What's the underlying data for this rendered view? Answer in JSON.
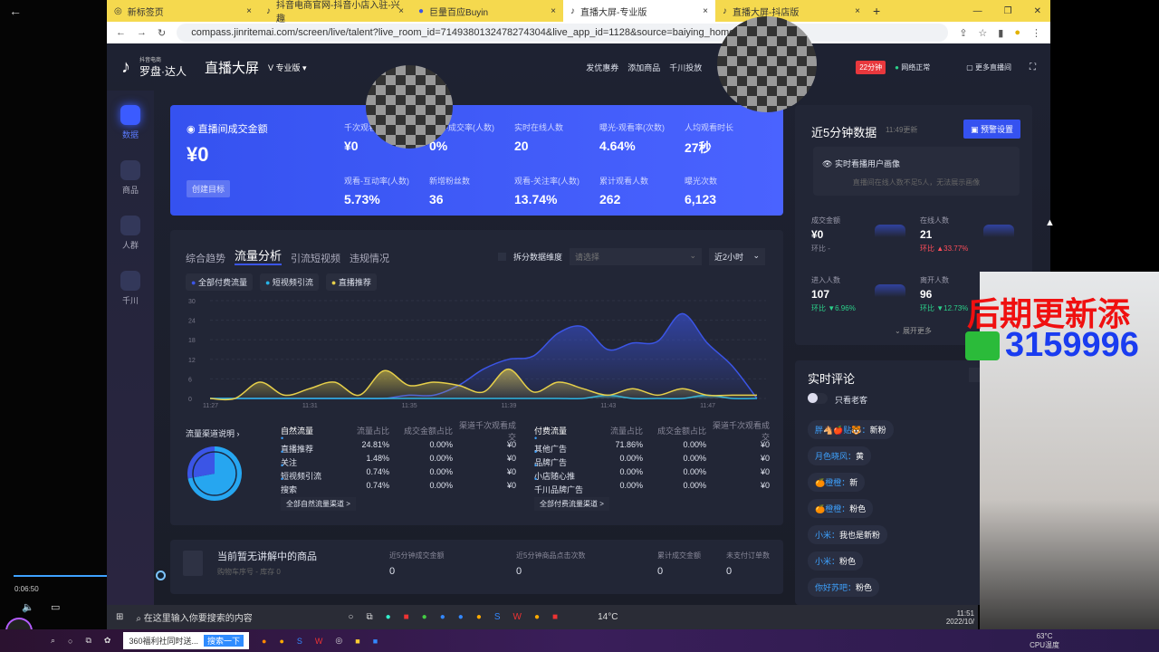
{
  "player": {
    "time": "0:06:50",
    "progress": 0.24
  },
  "browser": {
    "tabs": [
      {
        "label": "新标签页"
      },
      {
        "label": "抖音电商官网-抖音小店入驻-兴趣"
      },
      {
        "label": "巨量百应Buyin"
      },
      {
        "label": "直播大屏-专业版",
        "active": true
      },
      {
        "label": "直播大屏-抖店版"
      }
    ],
    "url": "compass.jinritemai.com/screen/live/talent?live_room_id=7149380132478274304&live_app_id=1128&source=baiying_home"
  },
  "header": {
    "logo_small": "抖音电商",
    "logo": "罗盘·达人",
    "title": "直播大屏",
    "edition": "专业版",
    "links": [
      "发优惠券",
      "添加商品",
      "千川投放"
    ],
    "duration_badge": "22分钟",
    "network": "网络正常",
    "more": "更多直播间"
  },
  "sidebar": [
    {
      "label": "数据",
      "active": true
    },
    {
      "label": "商品"
    },
    {
      "label": "人群"
    },
    {
      "label": "千川"
    }
  ],
  "summary": {
    "main_label": "直播间成交金额",
    "main_value": "¥0",
    "goal_button": "创建目标",
    "metrics": [
      {
        "k": "千次观看成交金额",
        "v": "¥0"
      },
      {
        "k": "观看-成交率(人数)",
        "v": "0%"
      },
      {
        "k": "实时在线人数",
        "v": "20"
      },
      {
        "k": "曝光-观看率(次数)",
        "v": "4.64%"
      },
      {
        "k": "人均观看时长",
        "v": "27秒"
      },
      {
        "k": "观看-互动率(人数)",
        "v": "5.73%"
      },
      {
        "k": "新增粉丝数",
        "v": "36"
      },
      {
        "k": "观看-关注率(人数)",
        "v": "13.74%"
      },
      {
        "k": "累计观看人数",
        "v": "262"
      },
      {
        "k": "曝光次数",
        "v": "6,123"
      }
    ]
  },
  "analysis": {
    "tabs": [
      "综合趋势",
      "流量分析",
      "引流短视频",
      "违规情况"
    ],
    "active_tab": 1,
    "split_label": "拆分数据维度",
    "select_placeholder": "请选择",
    "range": "近2小时"
  },
  "chart_data": {
    "type": "area",
    "x": [
      "11:27",
      "11:28",
      "11:29",
      "11:30",
      "11:31",
      "11:32",
      "11:33",
      "11:34",
      "11:35",
      "11:36",
      "11:37",
      "11:38",
      "11:39",
      "11:40",
      "11:41",
      "11:42",
      "11:43",
      "11:44",
      "11:45",
      "11:46",
      "11:47",
      "11:48",
      "11:49"
    ],
    "xticks": [
      "11:27",
      "11:31",
      "11:35",
      "11:39",
      "11:43",
      "11:47"
    ],
    "yticks": [
      0,
      6,
      12,
      18,
      24,
      30
    ],
    "ylim": [
      0,
      30
    ],
    "grid": true,
    "legend": "top-left",
    "series": [
      {
        "name": "全部付费流量",
        "color": "#3b55e6",
        "values": [
          0,
          0,
          0,
          0,
          0,
          0,
          0,
          0,
          1,
          1,
          4,
          9,
          12,
          13,
          20,
          22,
          15,
          17,
          17.5,
          26,
          17,
          10,
          0
        ]
      },
      {
        "name": "短视频引流",
        "color": "#27b3e6",
        "values": [
          0,
          0,
          0,
          0,
          0,
          0,
          0,
          0,
          0,
          0,
          0,
          0,
          0,
          0,
          0,
          0,
          1,
          0,
          0,
          0,
          1,
          0,
          0
        ]
      },
      {
        "name": "直播推荐",
        "color": "#e6cf4a",
        "values": [
          0,
          0,
          5,
          1,
          3,
          5,
          1,
          8.5,
          4,
          5,
          4,
          2,
          9,
          2,
          5,
          3,
          1,
          3,
          1,
          3,
          1,
          1,
          1
        ]
      }
    ]
  },
  "channels": {
    "title": "流量渠道说明",
    "pie": [
      {
        "label": "付费流量",
        "value": 71.86,
        "color": "#26a6f0"
      },
      {
        "label": "自然流量",
        "value": 27.77,
        "color": "#3b55e6"
      }
    ],
    "natural": {
      "head": [
        "自然流量",
        "流量占比",
        "成交金额占比",
        "渠道千次观看成交"
      ],
      "rows": [
        [
          "直播推荐",
          "24.81%",
          "0.00%",
          "¥0"
        ],
        [
          "关注",
          "1.48%",
          "0.00%",
          "¥0"
        ],
        [
          "短视频引流",
          "0.74%",
          "0.00%",
          "¥0"
        ],
        [
          "搜索",
          "0.74%",
          "0.00%",
          "¥0"
        ]
      ],
      "more": "全部自然流量渠道 >"
    },
    "paid": {
      "head": [
        "付费流量",
        "流量占比",
        "成交金额占比",
        "渠道千次观看成交"
      ],
      "rows": [
        [
          "其他广告",
          "71.86%",
          "0.00%",
          "¥0"
        ],
        [
          "品牌广告",
          "0.00%",
          "0.00%",
          "¥0"
        ],
        [
          "小店随心推",
          "0.00%",
          "0.00%",
          "¥0"
        ],
        [
          "千川品牌广告",
          "0.00%",
          "0.00%",
          "¥0"
        ]
      ],
      "more": "全部付费流量渠道 >"
    }
  },
  "product": {
    "title": "当前暂无讲解中的商品",
    "sub": "购物车序号 -  库存 0",
    "cols": [
      {
        "k": "近5分钟成交金额",
        "v": "0"
      },
      {
        "k": "近5分钟商品点击次数",
        "v": "0"
      },
      {
        "k": "累计成交金额",
        "v": "0"
      },
      {
        "k": "未支付订单数",
        "v": "0"
      }
    ]
  },
  "recent": {
    "title": "近5分钟数据",
    "updated": "11:49更新",
    "alert_button": "预警设置",
    "portrait_title": "实时看播用户画像",
    "portrait_note": "直播间在线人数不足5人，无法展示画像",
    "items": [
      {
        "k": "成交金额",
        "v": "¥0",
        "ratio": "环比 -",
        "dir": ""
      },
      {
        "k": "在线人数",
        "v": "21",
        "ratio": "环比 ▲33.77%",
        "dir": "up"
      },
      {
        "k": "进入人数",
        "v": "107",
        "ratio": "环比 ▼6.96%",
        "dir": "down"
      },
      {
        "k": "离开人数",
        "v": "96",
        "ratio": "环比 ▼12.73%",
        "dir": "down"
      }
    ],
    "expand": "展开更多"
  },
  "comments": {
    "title": "实时评论",
    "toggle_label": "只看老客",
    "toggle_on": false,
    "list": [
      {
        "u": "胖🐴🍎贴🐯：",
        "t": "新粉"
      },
      {
        "u": "月色晓风：",
        "t": "黄"
      },
      {
        "u": "🍊橙橙：",
        "t": "新"
      },
      {
        "u": "🍊橙橙：",
        "t": "粉色"
      },
      {
        "u": "小米：",
        "t": "我也是新粉"
      },
      {
        "u": "小米：",
        "t": "粉色"
      },
      {
        "u": "你好苏吧：",
        "t": "粉色"
      }
    ]
  },
  "overlay": {
    "line1": "后期更新添",
    "line2": "3159996"
  },
  "taskbar": {
    "search": "在这里输入你要搜索的内容",
    "weather": "14°C",
    "time": "11:51",
    "date": "2022/10/"
  },
  "outer_taskbar": {
    "ie_text": "360福利社同时送...",
    "search_button": "搜索一下",
    "cpu_temp": "63°C",
    "cpu_label": "CPU温度"
  },
  "colors": {
    "accent": "#3b55e6",
    "up": "#ff4d5a",
    "down": "#2bd18a"
  }
}
